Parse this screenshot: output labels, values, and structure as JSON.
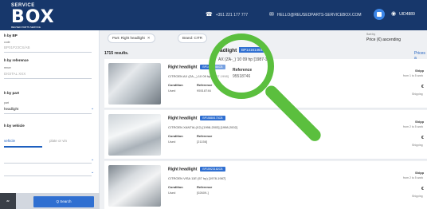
{
  "header": {
    "logo_small": "SERVICE",
    "logo_big": "BOX",
    "logo_sub": "REUSED PARTS SERVICE",
    "phone": "+351 221 177 777",
    "email": "HELLO@REUSEDPARTS-SERVICEBOX.COM",
    "user": "UID4889"
  },
  "sidebar": {
    "search_by_bp": "h by BP",
    "bp_field_small": "code",
    "bp_value": "BP01P23CS/AB",
    "search_by_reference": "h by reference",
    "ref_field_small": "rence",
    "ref_value": "DIGITAL XXX",
    "search_by_part": "h by part",
    "part_field_small": "part",
    "part_value": "headlight",
    "search_by_vehicle": "h by vehicle",
    "tab_active": "vehicle",
    "tab_other": "plate or vin",
    "clear_label": "ar",
    "search_label": "Q  Search"
  },
  "filters": {
    "chip1": "Part: Right headlight",
    "chip2": "Brand: CITR",
    "sort_label": "Sort by",
    "sort_value": "Price (€) ascending"
  },
  "results": {
    "count": "1715 results.",
    "prices_link": "Prices a",
    "condition_label": "Condition",
    "reference_label": "Reference",
    "shipping_label": "Shipp",
    "shipping_cost": "Shipping",
    "items": [
      {
        "title": "Right headlight",
        "bp": "BP14161464CB",
        "model": "CITROEN AX (ZA-_) 10 09 hp [1987-1998]",
        "condition": "Used",
        "reference": "95518746",
        "eta": "from 1 to 5 work",
        "price": "€"
      },
      {
        "title": "Right headlight",
        "bp": "BP15880173CB",
        "model": "CITROEN XANTIA (X2) [1998-2003] [1998-2002]",
        "condition": "Used",
        "reference": "[21156]",
        "eta": "from 2 to 5 work",
        "price": "€"
      },
      {
        "title": "Right headlight",
        "bp": "BP15923162CB",
        "model": "CITROEN VISA 11E (57 hp) [1978-1987]",
        "condition": "Used",
        "reference": "[02609-]",
        "eta": "from 2 to 5 work",
        "price": "€"
      }
    ]
  },
  "magnifier": {
    "title": "adlight",
    "bp": "BP14161464CB",
    "model": "AX (ZA-_) 10 09 hp [1987-1998",
    "reference_label": "Reference",
    "reference_value": "95518746"
  },
  "colors": {
    "header_bg": "#17376b",
    "accent": "#2f6fd1",
    "magnifier": "#5bbf3e"
  },
  "icons": [
    "phone-icon",
    "mail-icon",
    "cart-icon",
    "user-icon",
    "chevron-down-icon",
    "close-icon",
    "magnifier-icon"
  ]
}
